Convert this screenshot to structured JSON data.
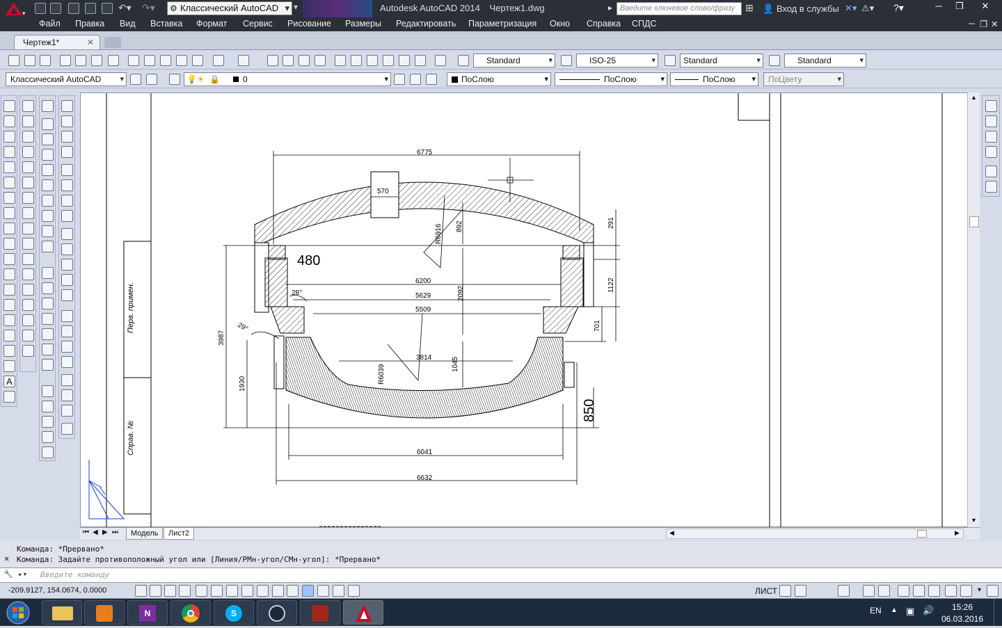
{
  "titlebar": {
    "workspace": "Классический AutoCAD",
    "app_title": "Autodesk AutoCAD 2014",
    "file_name": "Чертеж1.dwg",
    "search_placeholder": "Введите ключевое слово/фразу",
    "login": "Вход в службы"
  },
  "menu": [
    "Файл",
    "Правка",
    "Вид",
    "Вставка",
    "Формат",
    "Сервис",
    "Рисование",
    "Размеры",
    "Редактировать",
    "Параметризация",
    "Окно",
    "Справка",
    "СПДС"
  ],
  "document_tab": "Чертеж1*",
  "toolbar1": {
    "text_style": "Standard",
    "dim_style": "ISO-25",
    "table_style": "Standard",
    "mleader_style": "Standard"
  },
  "toolbar2": {
    "workspace": "Классический AutoCAD",
    "layer": "0",
    "color": "ПоСлою",
    "linetype": "ПоСлою",
    "lineweight": "ПоСлою",
    "plotstyle": "ПоЦвету"
  },
  "drawing": {
    "dims": {
      "d6775": "6775",
      "d570": "570",
      "d892": "892",
      "d291": "291",
      "r6916": "R6916",
      "d480": "480",
      "d6200": "6200",
      "d28a": "28°",
      "d5629": "5629",
      "d2092": "2092",
      "d1122": "1122",
      "d5509": "5509",
      "d29": "29°",
      "d701": "701",
      "d3987": "3987",
      "d3814": "3814",
      "d1045": "1045",
      "r6039": "R6039",
      "d1930": "1930",
      "d850": "850",
      "d6041": "6041",
      "d6632": "6632"
    },
    "frame_text_1": "Перв. примен.",
    "frame_text_2": "Справ. №"
  },
  "layout_tabs": [
    "Модель",
    "Лист2"
  ],
  "command": {
    "line1": "Команда: *Прервано*",
    "line2": "Команда: Задайте противоположный угол или [Линия/РМн-угол/СМн-угол]: *Прервано*",
    "placeholder": "Введите команду"
  },
  "status": {
    "coords": "-209.9127, 154.0674, 0.0000",
    "space": "ЛИСТ"
  },
  "taskbar": {
    "lang": "EN",
    "time": "15:26",
    "date": "06.03.2016"
  },
  "colors": {
    "app_bar": "#2b2f38",
    "autocad_red": "#c8102e",
    "taskbar": "#1d2b3e",
    "frame_blue": "#1a3cd9"
  }
}
